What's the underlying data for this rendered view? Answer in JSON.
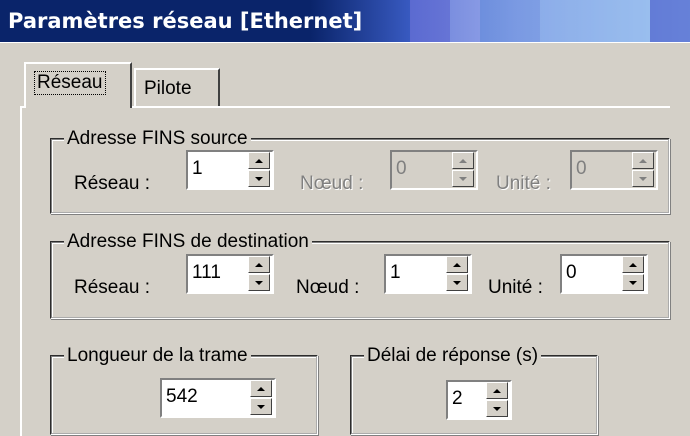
{
  "window": {
    "title": "Paramètres réseau [Ethernet]"
  },
  "tabs": [
    {
      "label": "Réseau",
      "active": true
    },
    {
      "label": "Pilote",
      "active": false
    }
  ],
  "fins_source": {
    "legend": "Adresse FINS source",
    "reseau_label": "Réseau :",
    "reseau_value": "1",
    "noeud_label": "Nœud :",
    "noeud_value": "0",
    "unite_label": "Unité :",
    "unite_value": "0"
  },
  "fins_destination": {
    "legend": "Adresse FINS de destination",
    "reseau_label": "Réseau :",
    "reseau_value": "111",
    "noeud_label": "Nœud :",
    "noeud_value": "1",
    "unite_label": "Unité :",
    "unite_value": "0"
  },
  "frame_length": {
    "legend": "Longueur de la trame",
    "value": "542"
  },
  "response_delay": {
    "legend": "Délai de réponse (s)",
    "value": "2"
  },
  "colors": {
    "titlebar": "#0a246a",
    "face": "#d4d0c8",
    "disabled_text": "#808080"
  }
}
